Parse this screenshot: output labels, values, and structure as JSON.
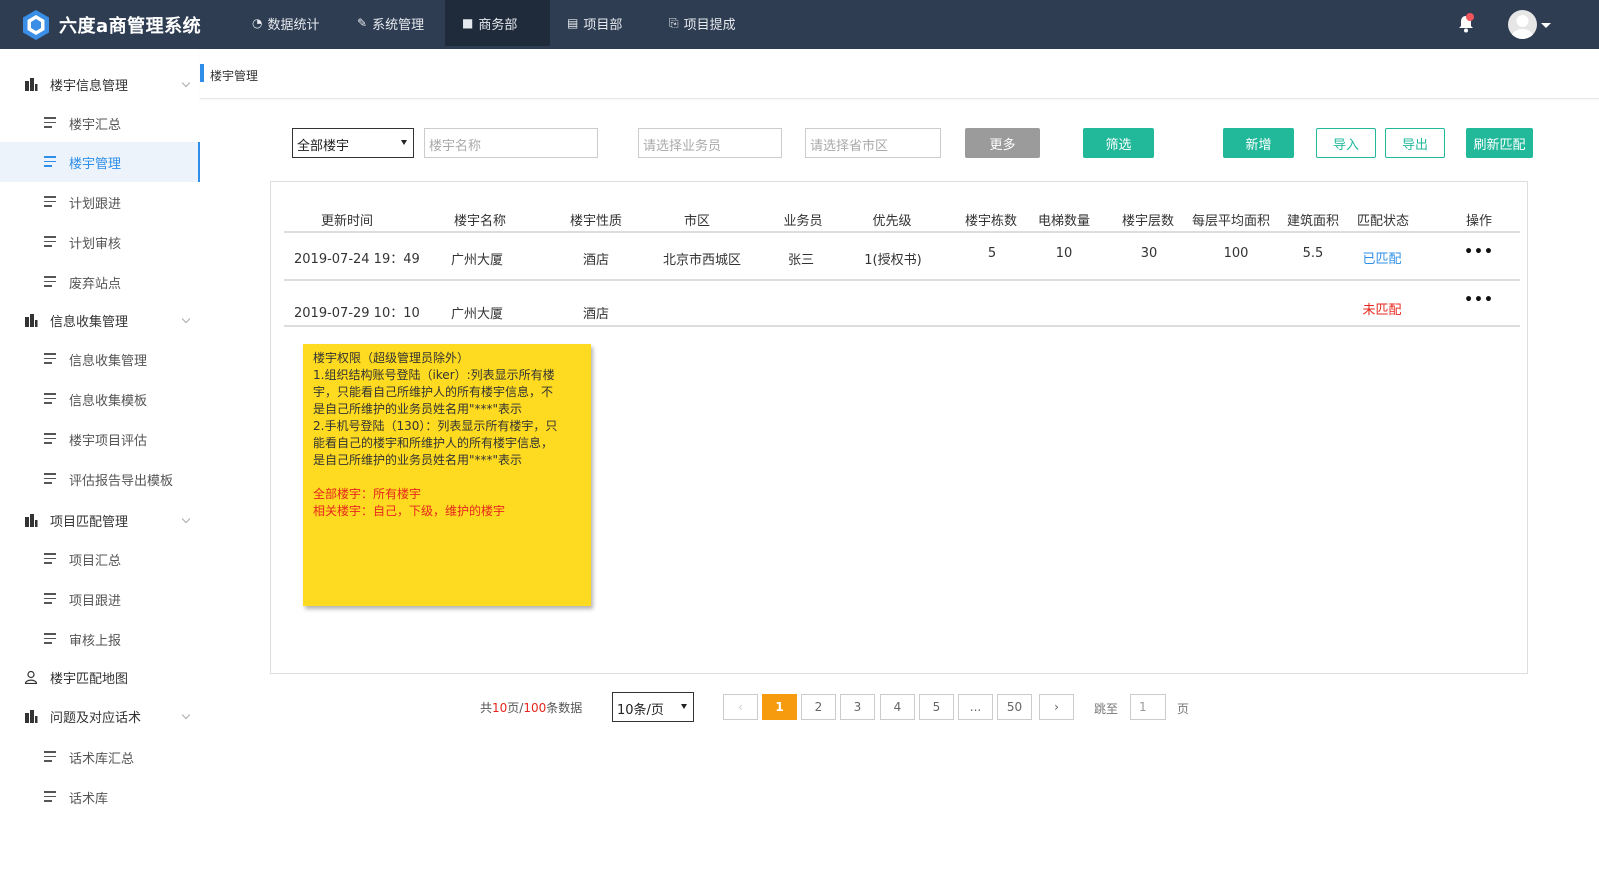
{
  "app": {
    "title": "六度a商管理系统"
  },
  "topnav": [
    {
      "label": "数据统计",
      "icon": "dashboard-icon"
    },
    {
      "label": "系统管理",
      "icon": "wrench-icon"
    },
    {
      "label": "商务部",
      "icon": "briefcase-icon",
      "active": true
    },
    {
      "label": "项目部",
      "icon": "list-icon"
    },
    {
      "label": "项目提成",
      "icon": "commission-icon"
    }
  ],
  "sidebar": {
    "groups": [
      {
        "label": "楼宇信息管理",
        "icon": "building-icon",
        "items": [
          "楼宇汇总",
          "楼宇管理",
          "计划跟进",
          "计划审核",
          "废弃站点"
        ]
      },
      {
        "label": "信息收集管理",
        "icon": "building-icon",
        "items": [
          "信息收集管理",
          "信息收集模板",
          "楼宇项目评估",
          "评估报告导出模板"
        ]
      },
      {
        "label": "项目匹配管理",
        "icon": "building-icon",
        "items": [
          "项目汇总",
          "项目跟进",
          "审核上报"
        ]
      },
      {
        "label": "楼宇匹配地图",
        "icon": "user-icon",
        "items": []
      },
      {
        "label": "问题及对应话术",
        "icon": "building-icon",
        "items": [
          "话术库汇总",
          "话术库"
        ]
      }
    ],
    "active_item": "楼宇管理"
  },
  "breadcrumb": "楼宇管理",
  "filters": {
    "building_scope": "全部楼宇",
    "name_placeholder": "楼宇名称",
    "salesperson_placeholder": "请选择业务员",
    "region_placeholder": "请选择省市区",
    "more_label": "更多",
    "filter_label": "筛选",
    "add_label": "新增",
    "import_label": "导入",
    "export_label": "导出",
    "refresh_label": "刷新匹配"
  },
  "table": {
    "headers": [
      "更新时间",
      "楼宇名称",
      "楼宇性质",
      "市区",
      "业务员",
      "优先级",
      "楼宇栋数",
      "电梯数量",
      "楼宇层数",
      "每层平均面积",
      "建筑面积",
      "匹配状态",
      "操作"
    ],
    "rows": [
      {
        "updated": "2019-07-24 19：49",
        "name": "广州大厦",
        "type": "酒店",
        "district": "北京市西城区",
        "salesperson": "张三",
        "priority": "1(授权书)",
        "buildings": "5",
        "elevators": "10",
        "floors": "30",
        "avg_area": "100",
        "total_area": "5.5",
        "status": "已匹配",
        "actions": "•••"
      },
      {
        "updated": "2019-07-29 10：10",
        "name": "广州大厦",
        "type": "酒店",
        "district": "",
        "salesperson": "",
        "priority": "",
        "buildings": "",
        "elevators": "",
        "floors": "",
        "avg_area": "",
        "total_area": "",
        "status": "未匹配",
        "actions": "•••"
      }
    ]
  },
  "note": {
    "lines": [
      "楼宇权限（超级管理员除外）",
      "1.组织结构账号登陆（iker）:列表显示所有楼",
      "宇，只能看自己所维护人的所有楼宇信息，不",
      "是自己所维护的业务员姓名用\"***\"表示",
      "2.手机号登陆（130）：列表显示所有楼宇，只",
      "能看自己的楼宇和所维护人的所有楼宇信息，",
      "是自己所维护的业务员姓名用\"***\"表示"
    ],
    "red_lines": [
      "全部楼宇：所有楼宇",
      "相关楼宇：自己，下级，维护的楼宇"
    ]
  },
  "pagination": {
    "prefix": "共",
    "pages": "10",
    "mid": "页/",
    "records": "100",
    "suffix": "条数据",
    "page_size": "10条/页",
    "prev": "‹",
    "next": "›",
    "page_buttons": [
      "1",
      "2",
      "3",
      "4",
      "5",
      "...",
      "50"
    ],
    "current": "1",
    "jump_label": "跳至",
    "jump_value": "1",
    "page_unit": "页"
  },
  "colors": {
    "topbar": "#2e3d52",
    "accent": "#2f8fe8",
    "teal": "#22b89a",
    "orange": "#f79b0e",
    "note": "#fedb20",
    "red": "#e6271e"
  }
}
